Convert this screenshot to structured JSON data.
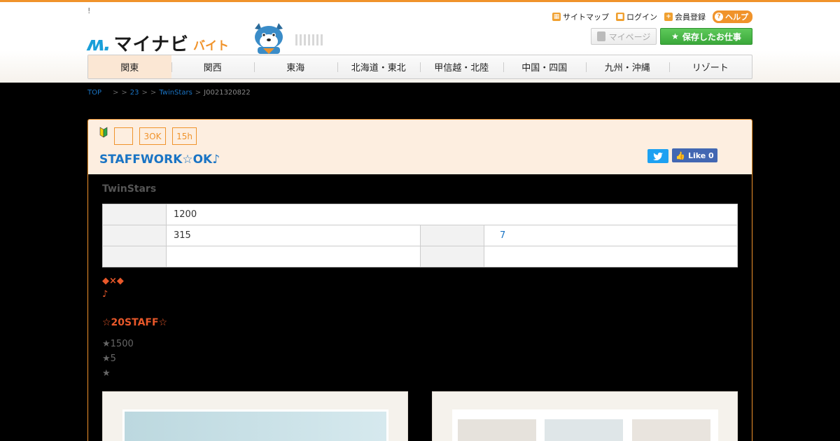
{
  "header": {
    "notice": "!",
    "logo": {
      "mark": "ʍ.",
      "mynavi": "マイナビ",
      "baito": "バイト"
    },
    "utility": [
      {
        "icon": "sitemap-icon",
        "label": "サイトマップ"
      },
      {
        "icon": "lock-icon",
        "label": "ログイン"
      },
      {
        "icon": "register-icon",
        "label": "会員登録"
      }
    ],
    "help_label": "ヘルプ",
    "mypage_label": "マイページ",
    "saved_jobs_label": "保存したお仕事",
    "nav": [
      "関東",
      "関西",
      "東海",
      "北海道・東北",
      "甲信越・北陸",
      "中国・四国",
      "九州・沖縄",
      "リゾート"
    ],
    "active_nav": "関東"
  },
  "breadcrumb": {
    "top": "TOP",
    "sep1": ">",
    "sep2": ">",
    "num": "23",
    "sep3": ">",
    "sep4": ">",
    "company": "TwinStars",
    "sep5": ">",
    "job_id": "J0021320822"
  },
  "job": {
    "tags": [
      "",
      "3OK",
      "15h"
    ],
    "title": "STAFFWORK☆OK♪",
    "twitter_label": "",
    "like_label": "Like 0",
    "company": "TwinStars",
    "table": {
      "row1": {
        "h1": "",
        "v1": "1200"
      },
      "row2": {
        "h1": "",
        "v1": "315",
        "h2": "",
        "v2": "7"
      },
      "row3": {
        "h1": "",
        "v1": "",
        "h2": "",
        "v2": ""
      }
    },
    "lead1": "◆×◆",
    "lead2": "♪",
    "lead3": "☆20STAFF☆",
    "points": [
      "★1500",
      "★5",
      "★"
    ]
  },
  "colors": {
    "brand_orange": "#f0932b",
    "brand_blue": "#1a9fd9",
    "link": "#1a74c4",
    "accent_red": "#e8582a",
    "green": "#3aa83a"
  }
}
